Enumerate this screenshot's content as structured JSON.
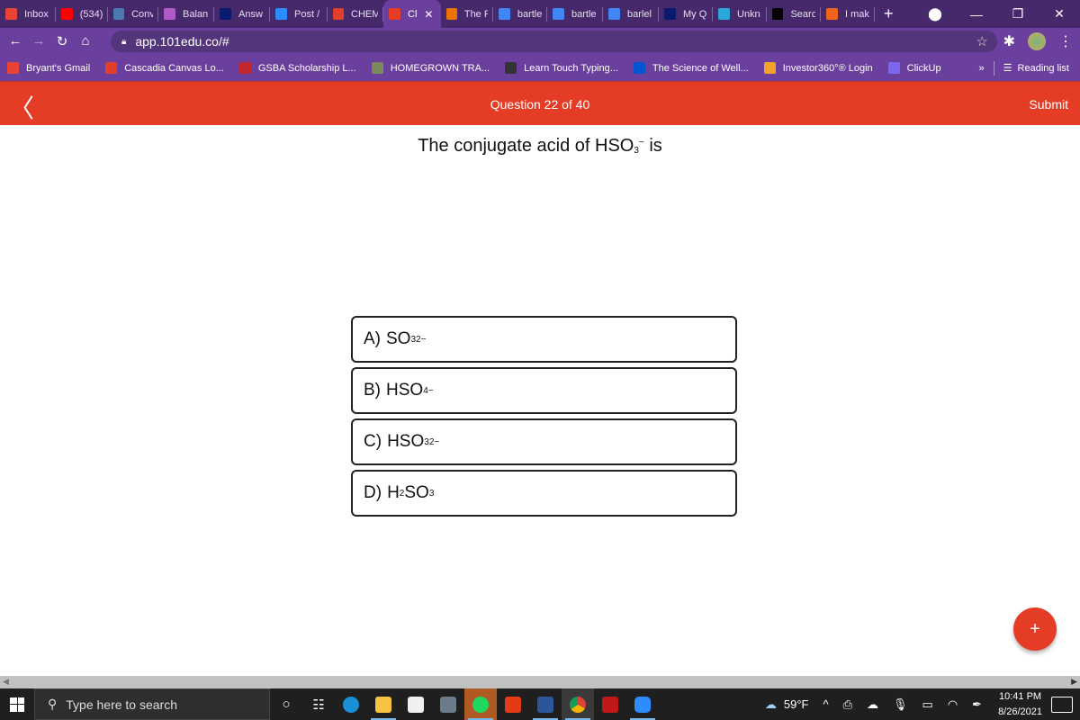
{
  "browser": {
    "tabs": [
      {
        "label": "Inbox",
        "icon": "gmail-icon",
        "color": "#ea4335"
      },
      {
        "label": "(534)",
        "icon": "youtube-icon",
        "color": "#ff0000"
      },
      {
        "label": "Conv",
        "icon": "convert-icon",
        "color": "#4a7ab0"
      },
      {
        "label": "Balan",
        "icon": "flask-icon",
        "color": "#b05ac8"
      },
      {
        "label": "Answ",
        "icon": "bartleby-b-icon",
        "color": "#0a1a6e"
      },
      {
        "label": "Post /",
        "icon": "zoom-icon",
        "color": "#2d8cff"
      },
      {
        "label": "CHEM",
        "icon": "canvas-icon",
        "color": "#e13f2b"
      },
      {
        "label": "Cl",
        "icon": "101edu-icon",
        "color": "#e53c25",
        "active": true
      },
      {
        "label": "The F",
        "icon": "chegg-c-icon",
        "color": "#eb7100"
      },
      {
        "label": "bartle",
        "icon": "google-icon",
        "color": "#4285f4"
      },
      {
        "label": "bartle",
        "icon": "google-icon",
        "color": "#4285f4"
      },
      {
        "label": "barlel",
        "icon": "google-icon",
        "color": "#4285f4"
      },
      {
        "label": "My Q",
        "icon": "bartleby-b-icon",
        "color": "#0a1a6e"
      },
      {
        "label": "Unkn",
        "icon": "lab-tube-icon",
        "color": "#2aa6d8"
      },
      {
        "label": "Searc",
        "icon": "square-logo-icon",
        "color": "#000000"
      },
      {
        "label": "I mak",
        "icon": "etsy-e-icon",
        "color": "#f1641e"
      }
    ],
    "new_tab_label": "+",
    "url": "app.101edu.co/#",
    "bookmarks": [
      {
        "label": "Bryant's Gmail",
        "icon": "gmail-icon",
        "color": "#ea4335"
      },
      {
        "label": "Cascadia Canvas Lo...",
        "icon": "canvas-icon",
        "color": "#e13f2b"
      },
      {
        "label": "GSBA Scholarship L...",
        "icon": "gsba-icon",
        "color": "#c0272d"
      },
      {
        "label": "HOMEGROWN TRA...",
        "icon": "bus-icon",
        "color": "#7a8a5a"
      },
      {
        "label": "Learn Touch Typing...",
        "icon": "typing-icon",
        "color": "#333333"
      },
      {
        "label": "The Science of Well...",
        "icon": "coursera-c-icon",
        "color": "#0056d2"
      },
      {
        "label": "Investor360°® Login",
        "icon": "investor360-icon",
        "color": "#f2a22a"
      },
      {
        "label": "ClickUp",
        "icon": "clickup-icon",
        "color": "#7b68ee"
      }
    ],
    "overflow_label": "»",
    "reading_list_label": "Reading list"
  },
  "quiz": {
    "progress_label": "Question 22 of 40",
    "submit_label": "Submit",
    "question": {
      "prefix": "The conjugate acid of HSO",
      "sub": "3",
      "sup": "−",
      "suffix": " is"
    },
    "choices": [
      {
        "letter": "A)",
        "parts": [
          [
            "t",
            "SO"
          ],
          [
            "sub",
            "3"
          ],
          [
            "sup",
            "2−"
          ]
        ]
      },
      {
        "letter": "B)",
        "parts": [
          [
            "t",
            "HSO"
          ],
          [
            "sub",
            "4"
          ],
          [
            "sup",
            "−"
          ]
        ]
      },
      {
        "letter": "C)",
        "parts": [
          [
            "t",
            "HSO"
          ],
          [
            "sub",
            "3"
          ],
          [
            "sup",
            "2−"
          ]
        ]
      },
      {
        "letter": "D)",
        "parts": [
          [
            "t",
            "H"
          ],
          [
            "sub",
            "2"
          ],
          [
            "t",
            "SO"
          ],
          [
            "sub",
            "3"
          ]
        ]
      }
    ],
    "fab_label": "+"
  },
  "taskbar": {
    "search_placeholder": "Type here to search",
    "weather": "59°F",
    "time": "10:41 PM",
    "date": "8/26/2021"
  }
}
